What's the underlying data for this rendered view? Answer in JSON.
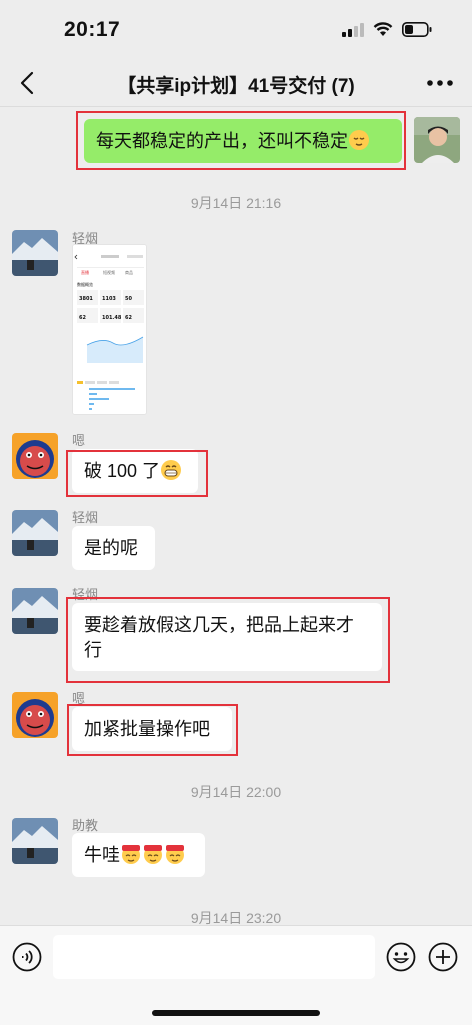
{
  "status_bar": {
    "time": "20:17"
  },
  "nav": {
    "title": "【共享ip计划】41号交付 (7)"
  },
  "messages": {
    "m1": {
      "text": "每天都稳定的产出，还叫不稳定"
    },
    "ts1": "9月14日 21:16",
    "m2": {
      "sender": "轻烟"
    },
    "m3": {
      "sender": "嗯",
      "text": "破 100 了"
    },
    "m4": {
      "sender": "轻烟",
      "text": "是的呢"
    },
    "m5": {
      "sender": "轻烟",
      "line1": "要趁着放假这几天，把品上起来才",
      "line2": "行"
    },
    "m6": {
      "sender": "嗯",
      "text": "加紧批量操作吧"
    },
    "ts2": "9月14日 22:00",
    "m7": {
      "sender": "助教",
      "text": "牛哇"
    },
    "ts3": "9月14日 23:20"
  },
  "screenshot": {
    "tabs": [
      "直播",
      "短视频",
      "商品"
    ],
    "section": "数据概览",
    "stats": [
      {
        "value": "3801"
      },
      {
        "value": "1103"
      },
      {
        "value": "50"
      },
      {
        "value": "62"
      },
      {
        "value": "101.48"
      },
      {
        "value": "62"
      }
    ]
  },
  "colors": {
    "highlight": "#e3323b",
    "self_bubble": "#95ec69",
    "background": "#ededed"
  }
}
